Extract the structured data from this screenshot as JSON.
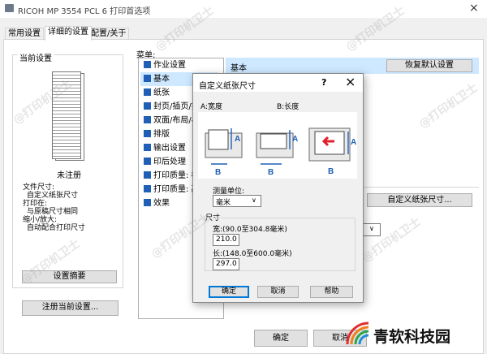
{
  "window": {
    "title": "RICOH MP 3554 PCL 6 打印首选项",
    "close_glyph": "×"
  },
  "tabs": [
    "常用设置",
    "详细的设置",
    "配置/关于"
  ],
  "left": {
    "group_title": "当前设置",
    "status": "未注册",
    "info_lines": [
      "文件尺寸:",
      "自定义纸张尺寸",
      "打印在:",
      "与原稿尺寸相同",
      "缩小/放大:",
      "自动配合打印尺寸"
    ],
    "summary_button": "设置摘要",
    "register_button": "注册当前设置..."
  },
  "menu": {
    "label": "菜单:",
    "items": [
      "作业设置",
      "基本",
      "纸张",
      "封页/插页/插",
      "双面/布局/小",
      "排版",
      "输出设置",
      "印后处理",
      "打印质量: 标",
      "打印质量: 高",
      "效果"
    ],
    "selected": 1
  },
  "right": {
    "header": "基本",
    "restore_button": "恢复默认设置",
    "custom_size_button": "自定义纸张尺寸..."
  },
  "bottom": {
    "ok": "确定",
    "cancel": "取消"
  },
  "dialog": {
    "title": "自定义纸张尺寸",
    "help_glyph": "?",
    "close_glyph": "×",
    "label_a": "A:宽度",
    "label_b": "B:长度",
    "unit_label": "测量单位:",
    "unit_value": "毫米",
    "size_group": "尺寸",
    "width_label": "宽:(90.0至304.8毫米)",
    "width_value": "210.0",
    "length_label": "长:(148.0至600.0毫米)",
    "length_value": "297.0",
    "ok": "确定",
    "cancel": "取消",
    "help": "帮助",
    "accent_color": "#1f5fb5"
  },
  "watermark": {
    "text": "@打印机卫士",
    "brand": "青软科技园"
  }
}
